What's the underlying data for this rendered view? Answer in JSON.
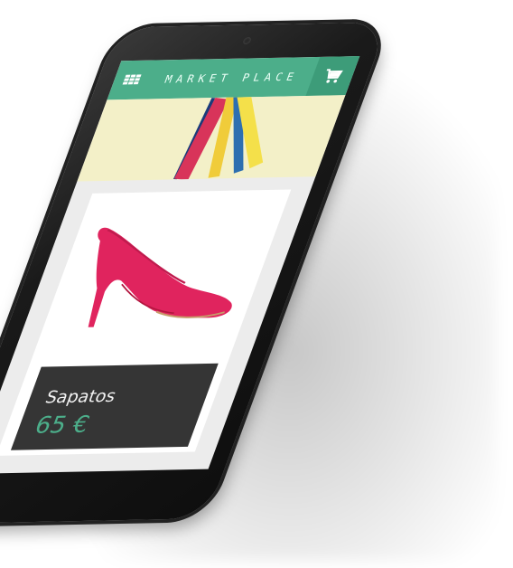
{
  "app": {
    "title": "MARKET PLACE",
    "menu_icon": "grid-icon",
    "cart_icon": "cart-icon",
    "accent_color": "#4cae8a"
  },
  "product": {
    "name": "Sapatos",
    "price": "65 €",
    "image": "red-high-heel-shoe"
  }
}
